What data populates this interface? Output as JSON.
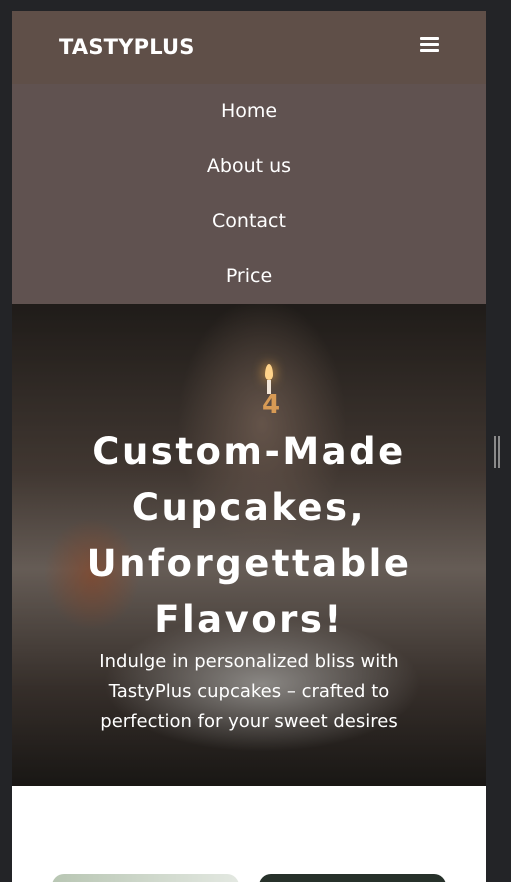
{
  "navbar": {
    "brand": "TASTYPLUS",
    "toggle_icon": "hamburger-menu-icon",
    "menu_items": [
      {
        "label": "Home"
      },
      {
        "label": "About us"
      },
      {
        "label": "Contact"
      },
      {
        "label": "Price"
      }
    ],
    "colors": {
      "bar": "#5f4f48",
      "menu": "#605250"
    }
  },
  "hero": {
    "title": "Custom-Made Cupcakes, Unforgettable Flavors!",
    "subtitle": "Indulge in personalized bliss with TastyPlus cupcakes – crafted to perfection for your sweet desires",
    "candle_digit": "4"
  },
  "colors": {
    "background": "#232427",
    "page": "#ffffff"
  }
}
